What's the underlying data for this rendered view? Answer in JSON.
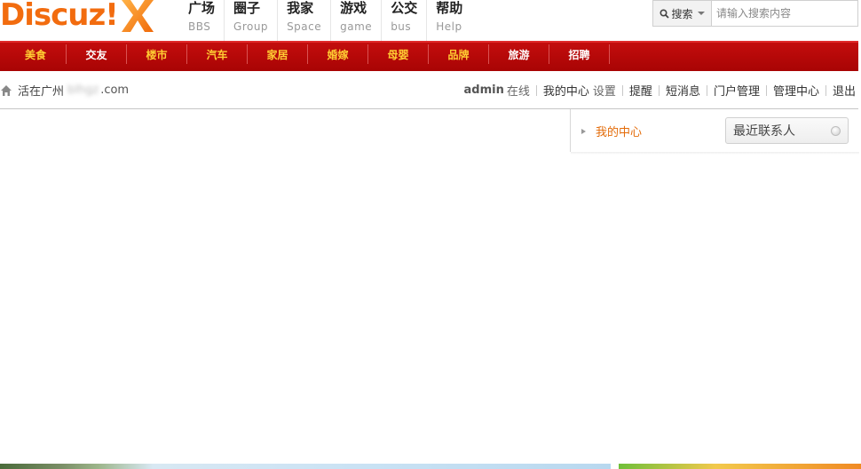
{
  "header": {
    "logo_text": "Discuz!",
    "nav": [
      {
        "title": "广场",
        "sub": "BBS"
      },
      {
        "title": "圈子",
        "sub": "Group"
      },
      {
        "title": "我家",
        "sub": "Space"
      },
      {
        "title": "游戏",
        "sub": "game"
      },
      {
        "title": "公交",
        "sub": "bus"
      },
      {
        "title": "帮助",
        "sub": "Help"
      }
    ],
    "search": {
      "type_label": "搜索",
      "placeholder": "请输入搜索内容"
    }
  },
  "categories": [
    "美食",
    "交友",
    "楼市",
    "汽车",
    "家居",
    "婚嫁",
    "母婴",
    "品牌",
    "旅游",
    "招聘"
  ],
  "breadcrumb": {
    "site_name": "活在广州",
    "domain_tail": ".com"
  },
  "user_nav": {
    "username": "admin",
    "status": "在线",
    "my_center": "我的中心",
    "settings": "设置",
    "reminders": "提醒",
    "messages": "短消息",
    "portal_admin": "门户管理",
    "admin_center": "管理中心",
    "logout": "退出"
  },
  "right_panel": {
    "my_center_label": "我的中心",
    "contacts_label": "最近联系人"
  },
  "colors": {
    "brand_orange": "#f26c0f",
    "category_bar_red": "#b30909",
    "category_text_gold": "#ffcc33",
    "link_orange": "#e36b09"
  }
}
